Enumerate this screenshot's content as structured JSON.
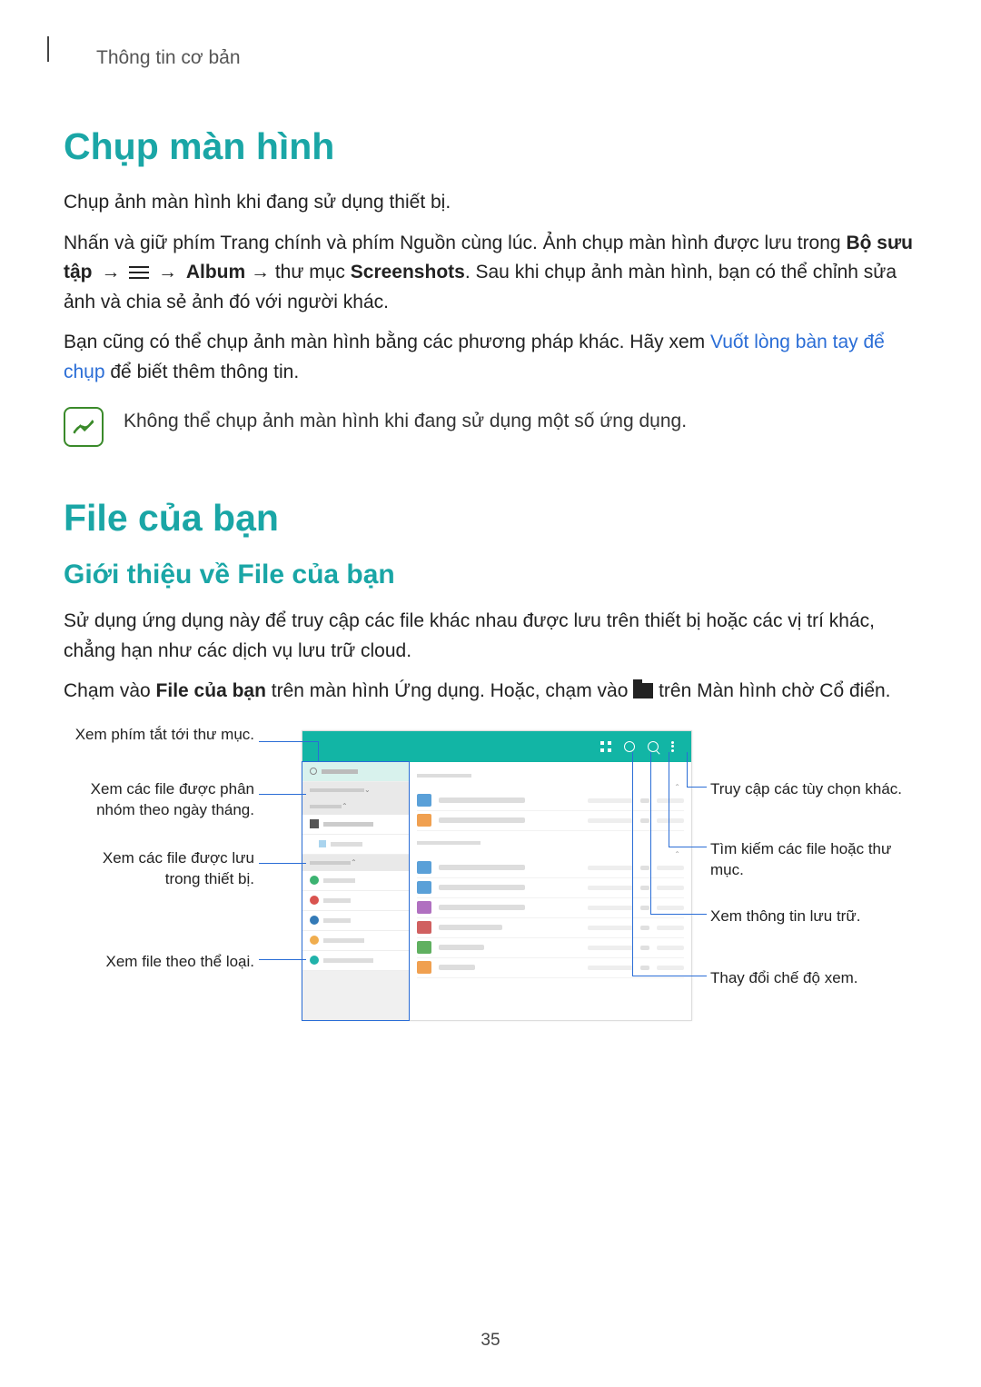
{
  "header": "Thông tin cơ bản",
  "section1": {
    "title": "Chụp màn hình",
    "p1": "Chụp ảnh màn hình khi đang sử dụng thiết bị.",
    "p2a": "Nhấn và giữ phím Trang chính và phím Nguồn cùng lúc. Ảnh chụp màn hình được lưu trong ",
    "p2b": "Bộ sưu tập",
    "p2arrow": " → ",
    "p2album": "Album",
    "p2c": " → thư mục ",
    "p2d": "Screenshots",
    "p2e": ". Sau khi chụp ảnh màn hình, bạn có thể chỉnh sửa ảnh và chia sẻ ảnh đó với người khác.",
    "p3a": "Bạn cũng có thể chụp ảnh màn hình bằng các phương pháp khác. Hãy xem ",
    "p3link": "Vuốt lòng bàn tay để chụp",
    "p3b": " để biết thêm thông tin.",
    "note": "Không thể chụp ảnh màn hình khi đang sử dụng một số ứng dụng."
  },
  "section2": {
    "title": "File của bạn",
    "subtitle": "Giới thiệu về File của bạn",
    "p1": "Sử dụng ứng dụng này để truy cập các file khác nhau được lưu trên thiết bị hoặc các vị trí khác, chẳng hạn như các dịch vụ lưu trữ cloud.",
    "p2a": "Chạm vào ",
    "p2b": "File của bạn",
    "p2c": " trên màn hình Ứng dụng. Hoặc, chạm vào ",
    "p2d": " trên Màn hình chờ Cổ điển."
  },
  "callouts": {
    "c1": "Xem phím tắt tới thư mục.",
    "c2": "Xem các file được phân nhóm theo ngày tháng.",
    "c3": "Xem các file được lưu trong thiết bị.",
    "c4": "Xem file theo thể loại.",
    "r1": "Truy cập các tùy chọn khác.",
    "r2": "Tìm kiếm các file hoặc thư mục.",
    "r3": "Xem thông tin lưu trữ.",
    "r4": "Thay đổi chế độ xem."
  },
  "page_number": "35"
}
